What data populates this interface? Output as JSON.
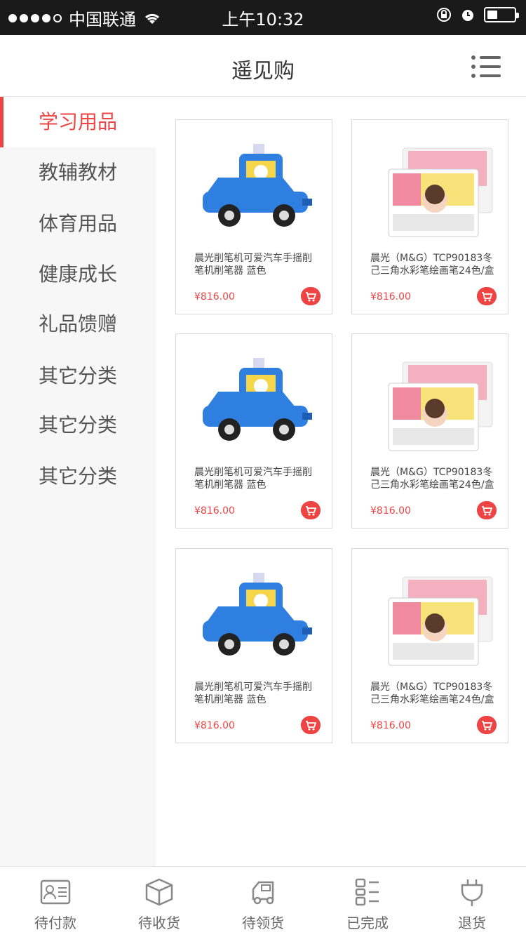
{
  "status_bar": {
    "carrier": "中国联通",
    "time": "上午10:32"
  },
  "header": {
    "title": "遥见购"
  },
  "sidebar": {
    "items": [
      {
        "label": "学习用品",
        "active": true
      },
      {
        "label": "教辅教材",
        "active": false
      },
      {
        "label": "体育用品",
        "active": false
      },
      {
        "label": "健康成长",
        "active": false
      },
      {
        "label": "礼品馈赠",
        "active": false
      },
      {
        "label": "其它分类",
        "active": false
      },
      {
        "label": "其它分类",
        "active": false
      },
      {
        "label": "其它分类",
        "active": false
      }
    ]
  },
  "products": [
    {
      "name": "晨光削笔机可爱汽车手摇削笔机削笔器 蓝色",
      "price": "¥816.00",
      "image": "blue-car-sharpener"
    },
    {
      "name": "晨光（M&G）TCP90183冬己三角水彩笔绘画笔24色/盒",
      "price": "¥816.00",
      "image": "watercolor-pens"
    },
    {
      "name": "晨光削笔机可爱汽车手摇削笔机削笔器 蓝色",
      "price": "¥816.00",
      "image": "blue-car-sharpener"
    },
    {
      "name": "晨光（M&G）TCP90183冬己三角水彩笔绘画笔24色/盒",
      "price": "¥816.00",
      "image": "watercolor-pens"
    },
    {
      "name": "晨光削笔机可爱汽车手摇削笔机削笔器 蓝色",
      "price": "¥816.00",
      "image": "blue-car-sharpener"
    },
    {
      "name": "晨光（M&G）TCP90183冬己三角水彩笔绘画笔24色/盒",
      "price": "¥816.00",
      "image": "watercolor-pens"
    }
  ],
  "tabbar": {
    "items": [
      {
        "label": "待付款",
        "icon": "id-card-icon"
      },
      {
        "label": "待收货",
        "icon": "box-icon"
      },
      {
        "label": "待领货",
        "icon": "truck-icon"
      },
      {
        "label": "已完成",
        "icon": "list-icon"
      },
      {
        "label": "退货",
        "icon": "plug-icon"
      }
    ]
  },
  "colors": {
    "accent": "#ee4444",
    "sidebar_bg": "#f7f7f7",
    "text": "#555555"
  }
}
